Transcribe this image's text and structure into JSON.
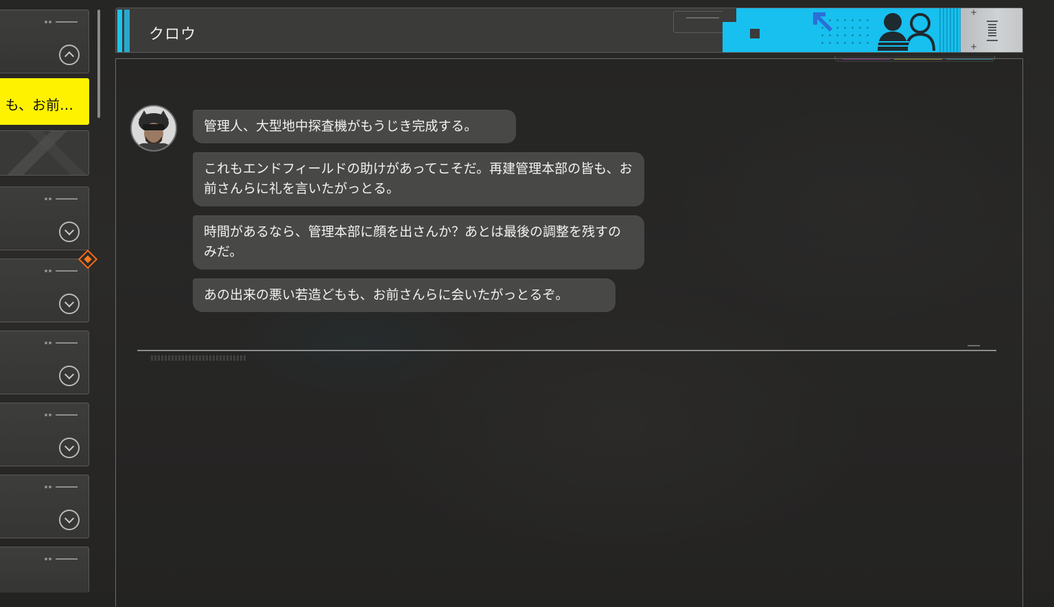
{
  "sidebar": {
    "selected_item_text": "も、お前…"
  },
  "header": {
    "title": "クロウ"
  },
  "chat": {
    "messages": [
      {
        "text": "管理人、大型地中探査機がもうじき完成する。"
      },
      {
        "text": "これもエンドフィールドの助けがあってこそだ。再建管理本部の皆も、お前さんらに礼を言いたがっとる。"
      },
      {
        "text": "時間があるなら、管理本部に顔を出さんか？あとは最後の調整を残すのみだ。"
      },
      {
        "text": "あの出来の悪い若造どもも、お前さんらに会いたがっとるぞ。"
      }
    ]
  },
  "colors": {
    "accent_cyan": "#17c0ef",
    "selected_yellow": "#fff200",
    "notification_orange": "#ff6a13"
  },
  "icons": [
    "collapse-chevron-icon",
    "expand-chevron-icon",
    "contacts-icon",
    "arrow-icon",
    "menu-icon",
    "notification-diamond-icon"
  ]
}
